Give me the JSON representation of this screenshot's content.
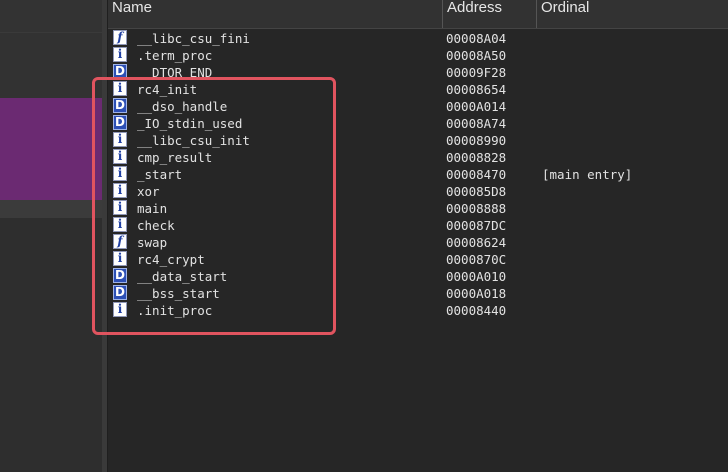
{
  "header": {
    "name": "Name",
    "address": "Address",
    "ordinal": "Ordinal"
  },
  "rows": [
    {
      "icon": "f",
      "name": "__libc_csu_fini",
      "address": "00008A04",
      "ordinal": ""
    },
    {
      "icon": "i",
      "name": ".term_proc",
      "address": "00008A50",
      "ordinal": ""
    },
    {
      "icon": "D",
      "name": "__DTOR_END__",
      "address": "00009F28",
      "ordinal": ""
    },
    {
      "icon": "i",
      "name": "rc4_init",
      "address": "00008654",
      "ordinal": ""
    },
    {
      "icon": "D",
      "name": "__dso_handle",
      "address": "0000A014",
      "ordinal": ""
    },
    {
      "icon": "D",
      "name": "_IO_stdin_used",
      "address": "00008A74",
      "ordinal": ""
    },
    {
      "icon": "i",
      "name": "__libc_csu_init",
      "address": "00008990",
      "ordinal": ""
    },
    {
      "icon": "i",
      "name": "cmp_result",
      "address": "00008828",
      "ordinal": ""
    },
    {
      "icon": "i",
      "name": "_start",
      "address": "00008470",
      "ordinal": "[main entry]"
    },
    {
      "icon": "i",
      "name": "xor",
      "address": "000085D8",
      "ordinal": ""
    },
    {
      "icon": "i",
      "name": "main",
      "address": "00008888",
      "ordinal": ""
    },
    {
      "icon": "i",
      "name": "check",
      "address": "000087DC",
      "ordinal": ""
    },
    {
      "icon": "f",
      "name": "swap",
      "address": "00008624",
      "ordinal": ""
    },
    {
      "icon": "i",
      "name": "rc4_crypt",
      "address": "0000870C",
      "ordinal": ""
    },
    {
      "icon": "D",
      "name": "__data_start",
      "address": "0000A010",
      "ordinal": ""
    },
    {
      "icon": "D",
      "name": "__bss_start",
      "address": "0000A018",
      "ordinal": ""
    },
    {
      "icon": "i",
      "name": ".init_proc",
      "address": "00008440",
      "ordinal": ""
    }
  ],
  "colors": {
    "highlight": "#e0545f",
    "left_panel_accent": "#6b2a72"
  }
}
